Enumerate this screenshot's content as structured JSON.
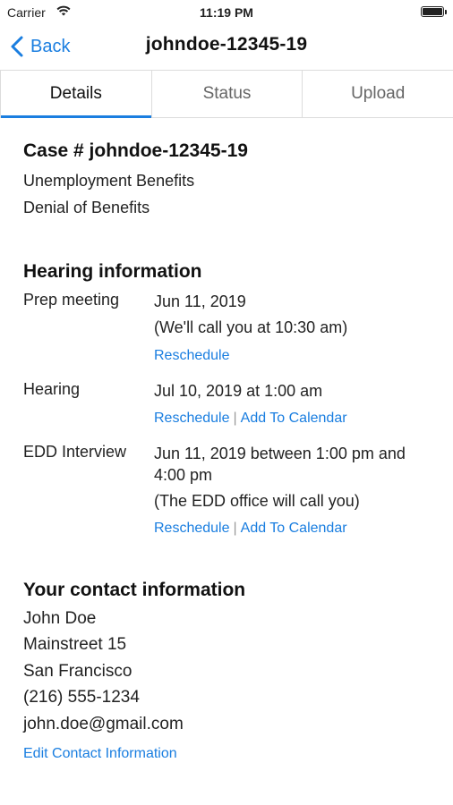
{
  "status_bar": {
    "carrier": "Carrier",
    "time": "11:19 PM",
    "battery_level": 1.0
  },
  "nav": {
    "back_label": "Back",
    "title": "johndoe-12345-19"
  },
  "tabs": [
    {
      "label": "Details",
      "active": true
    },
    {
      "label": "Status",
      "active": false
    },
    {
      "label": "Upload",
      "active": false
    }
  ],
  "case": {
    "heading": "Case # johndoe-12345-19",
    "type": "Unemployment Benefits",
    "issue": "Denial of Benefits"
  },
  "hearing": {
    "heading": "Hearing information",
    "prep": {
      "label": "Prep meeting",
      "date": "Jun 11, 2019",
      "note": "(We'll call you at 10:30 am)",
      "reschedule": "Reschedule"
    },
    "hearing": {
      "label": "Hearing",
      "date": "Jul 10, 2019 at 1:00 am",
      "reschedule": "Reschedule",
      "separator": "|",
      "add_calendar": "Add To Calendar"
    },
    "edd": {
      "label": "EDD Interview",
      "date": "Jun 11, 2019 between 1:00 pm and 4:00 pm",
      "note": "(The EDD office will call you)",
      "reschedule": "Reschedule",
      "separator": "|",
      "add_calendar": "Add To Calendar"
    }
  },
  "contact": {
    "heading": "Your contact information",
    "name": "John Doe",
    "street": "Mainstreet 15",
    "city": "San Francisco",
    "phone": "(216) 555-1234",
    "email": "john.doe@gmail.com",
    "edit_link": "Edit Contact Information"
  },
  "colors": {
    "accent": "#1a7ee0",
    "text": "#222222",
    "divider": "#dcdcdc"
  }
}
